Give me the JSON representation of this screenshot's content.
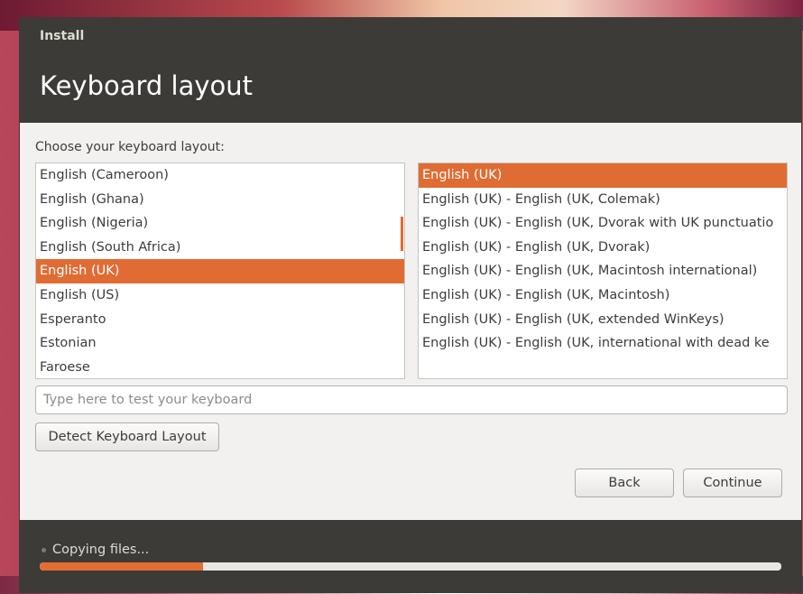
{
  "window": {
    "app_title": "Install",
    "page_title": "Keyboard layout"
  },
  "layout_prompt": "Choose your keyboard layout:",
  "layouts": {
    "items": [
      "English (Cameroon)",
      "English (Ghana)",
      "English (Nigeria)",
      "English (South Africa)",
      "English (UK)",
      "English (US)",
      "Esperanto",
      "Estonian",
      "Faroese"
    ],
    "selected": "English (UK)"
  },
  "variants": {
    "items": [
      "English (UK)",
      "English (UK) - English (UK, Colemak)",
      "English (UK) - English (UK, Dvorak with UK punctuatio",
      "English (UK) - English (UK, Dvorak)",
      "English (UK) - English (UK, Macintosh international)",
      "English (UK) - English (UK, Macintosh)",
      "English (UK) - English (UK, extended WinKeys)",
      "English (UK) - English (UK, international with dead ke"
    ],
    "selected": "English (UK)"
  },
  "test_field": {
    "value": "",
    "placeholder": "Type here to test your keyboard"
  },
  "buttons": {
    "detect": "Detect Keyboard Layout",
    "back": "Back",
    "continue": "Continue"
  },
  "status": {
    "text": "Copying files...",
    "progress": 0.22
  },
  "colors": {
    "accent": "#e06c34",
    "header": "#3c3b37",
    "window": "#f2f1f0"
  }
}
